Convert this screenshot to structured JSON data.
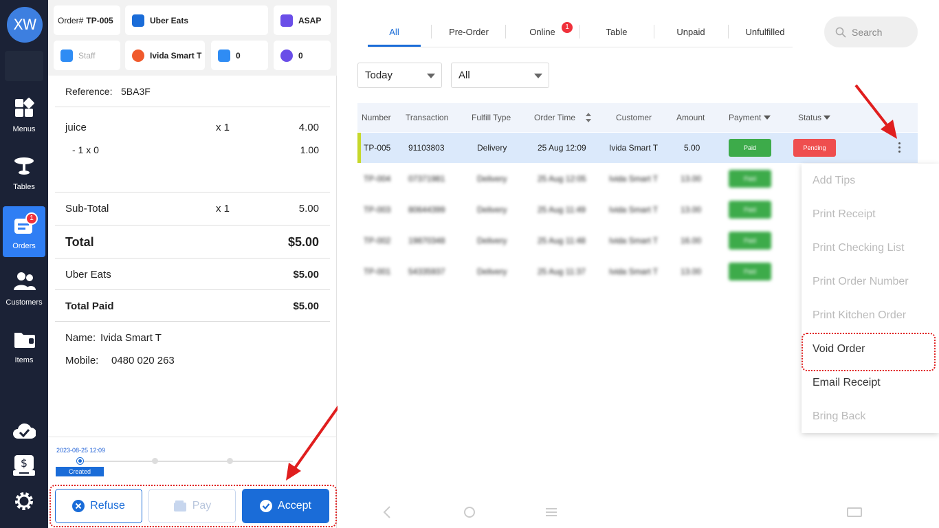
{
  "sidebar": {
    "logo": "XW",
    "items": [
      {
        "label": "Menus",
        "icon": "menus-icon"
      },
      {
        "label": "Tables",
        "icon": "tables-icon"
      },
      {
        "label": "Orders",
        "icon": "orders-icon",
        "badge": "1",
        "active": true
      },
      {
        "label": "Customers",
        "icon": "customers-icon"
      },
      {
        "label": "Items",
        "icon": "items-icon"
      }
    ],
    "bottom_icons": [
      "cloud-check-icon",
      "cash-register-icon",
      "settings-icon"
    ]
  },
  "order": {
    "order_label": "Order#",
    "order_number": "TP-005",
    "source": "Uber Eats",
    "timing": "ASAP",
    "staff_placeholder": "Staff",
    "customer": "Ivida Smart T",
    "guests": "0",
    "extra_count": "0",
    "reference_label": "Reference:",
    "reference_value": "5BA3F",
    "items": [
      {
        "name": "juice",
        "qty": "x 1",
        "price": "4.00"
      },
      {
        "name": "- 1 x 0",
        "qty": "",
        "price": "1.00"
      }
    ],
    "subtotal_label": "Sub-Total",
    "subtotal_qty": "x 1",
    "subtotal_value": "5.00",
    "total_label": "Total",
    "total_value": "$5.00",
    "payment_label": "Uber Eats",
    "payment_value": "$5.00",
    "total_paid_label": "Total Paid",
    "total_paid_value": "$5.00",
    "name_label": "Name:",
    "name_value": "Ivida Smart T",
    "mobile_label": "Mobile:",
    "mobile_value": "0480 020 263",
    "timeline_date": "2023-08-25 12:09",
    "timeline_status": "Created",
    "btn_refuse": "Refuse",
    "btn_pay": "Pay",
    "btn_accept": "Accept"
  },
  "tabs": [
    {
      "label": "All",
      "active": true
    },
    {
      "label": "Pre-Order"
    },
    {
      "label": "Online",
      "badge": "1"
    },
    {
      "label": "Table"
    },
    {
      "label": "Unpaid"
    },
    {
      "label": "Unfulfilled"
    }
  ],
  "search_placeholder": "Search",
  "filters": {
    "date": "Today",
    "type": "All"
  },
  "table": {
    "headers": [
      "Number",
      "Transaction",
      "Fulfill Type",
      "Order Time",
      "Customer",
      "Amount",
      "Payment",
      "Status"
    ],
    "rows": [
      {
        "number": "TP-005",
        "transaction": "91103803",
        "fulfill": "Delivery",
        "time": "25 Aug 12:09",
        "customer": "Ivida Smart T",
        "amount": "5.00",
        "payment": "Paid",
        "status": "Pending"
      },
      {
        "number": "TP-004",
        "transaction": "07371981",
        "fulfill": "Delivery",
        "time": "25 Aug 12:05",
        "customer": "Ivida Smart T",
        "amount": "13.00",
        "payment": "Paid",
        "status": ""
      },
      {
        "number": "TP-003",
        "transaction": "80644399",
        "fulfill": "Delivery",
        "time": "25 Aug 11:49",
        "customer": "Ivida Smart T",
        "amount": "13.00",
        "payment": "Paid",
        "status": ""
      },
      {
        "number": "TP-002",
        "transaction": "19870348",
        "fulfill": "Delivery",
        "time": "25 Aug 11:48",
        "customer": "Ivida Smart T",
        "amount": "16.00",
        "payment": "Paid",
        "status": ""
      },
      {
        "number": "TP-001",
        "transaction": "54335937",
        "fulfill": "Delivery",
        "time": "25 Aug 11:37",
        "customer": "Ivida Smart T",
        "amount": "13.00",
        "payment": "Paid",
        "status": ""
      }
    ]
  },
  "context_menu": [
    {
      "label": "Add Tips",
      "enabled": false
    },
    {
      "label": "Print Receipt",
      "enabled": false
    },
    {
      "label": "Print Checking List",
      "enabled": false
    },
    {
      "label": "Print Order Number",
      "enabled": false
    },
    {
      "label": "Print Kitchen Order",
      "enabled": false
    },
    {
      "label": "Void Order",
      "enabled": true,
      "highlighted": true
    },
    {
      "label": "Email Receipt",
      "enabled": true
    },
    {
      "label": "Bring Back",
      "enabled": false
    }
  ],
  "colors": {
    "accent": "#1a6cd8",
    "sidebar": "#1b2236",
    "paid": "#3dab4a",
    "pending": "#ef4e4e",
    "annotation": "#e01e1e"
  }
}
